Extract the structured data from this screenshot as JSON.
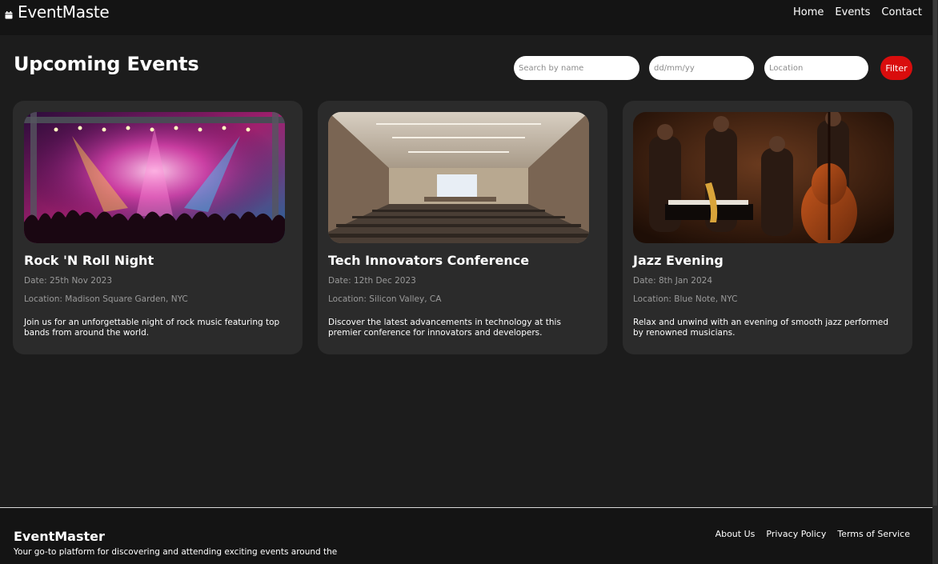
{
  "header": {
    "brand": "EventMaste",
    "brand_icon": "calendar-icon",
    "nav": [
      "Home",
      "Events",
      "Contact"
    ]
  },
  "main": {
    "title": "Upcoming Events",
    "filters": {
      "name_placeholder": "Search by name",
      "date_placeholder": "dd/mm/yy",
      "location_placeholder": "Location",
      "button_label": "Filter"
    },
    "events": [
      {
        "title": "Rock 'N Roll Night",
        "date": "Date: 25th Nov 2023",
        "location": "Location: Madison Square Garden, NYC",
        "description": "Join us for an unforgettable night of rock music featuring top bands from around the world.",
        "image": "concert-stage-photo"
      },
      {
        "title": "Tech Innovators Conference",
        "date": "Date: 12th Dec 2023",
        "location": "Location: Silicon Valley, CA",
        "description": "Discover the latest advancements in technology at this premier conference for innovators and developers.",
        "image": "conference-hall-photo"
      },
      {
        "title": "Jazz Evening",
        "date": "Date: 8th Jan 2024",
        "location": "Location: Blue Note, NYC",
        "description": "Relax and unwind with an evening of smooth jazz performed by renowned musicians.",
        "image": "jazz-band-photo"
      }
    ]
  },
  "footer": {
    "brand": "EventMaster",
    "tagline": "Your go-to platform for discovering and attending exciting events around the",
    "links": [
      "About Us",
      "Privacy Policy",
      "Terms of Service"
    ]
  },
  "colors": {
    "background": "#1c1c1c",
    "header": "#141414",
    "card": "#2b2b2b",
    "accent": "#d90d0d"
  }
}
